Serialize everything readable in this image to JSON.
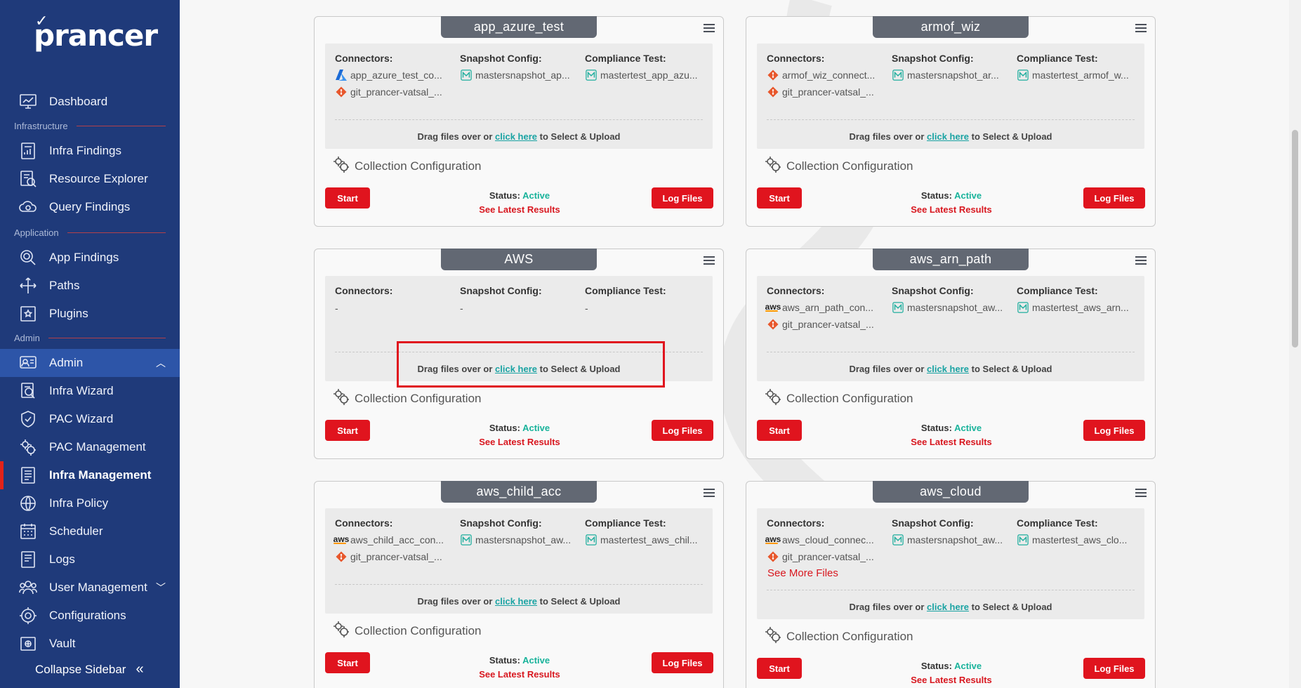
{
  "brand": "prancer",
  "sidebar": {
    "dashboard": "Dashboard",
    "sections": {
      "infrastructure": "Infrastructure",
      "application": "Application",
      "admin": "Admin"
    },
    "items": {
      "infra_findings": "Infra Findings",
      "resource_explorer": "Resource Explorer",
      "query_findings": "Query Findings",
      "app_findings": "App Findings",
      "paths": "Paths",
      "plugins": "Plugins",
      "admin": "Admin",
      "infra_wizard": "Infra Wizard",
      "pac_wizard": "PAC Wizard",
      "pac_management": "PAC Management",
      "infra_management": "Infra Management",
      "infra_policy": "Infra Policy",
      "scheduler": "Scheduler",
      "logs": "Logs",
      "user_management": "User Management",
      "configurations": "Configurations",
      "vault": "Vault"
    },
    "collapse": "Collapse Sidebar"
  },
  "labels": {
    "connectors": "Connectors:",
    "snapshot": "Snapshot Config:",
    "compliance": "Compliance Test:",
    "drag_pre": "Drag files over or ",
    "drag_link": "click here",
    "drag_post": " to Select & Upload",
    "collection": "Collection Configuration",
    "start": "Start",
    "log_files": "Log Files",
    "status": "Status: ",
    "active": "Active",
    "latest": "See Latest Results",
    "see_more": "See More Files",
    "dash": "-"
  },
  "cards": [
    {
      "title": "app_azure_test",
      "conn1": "app_azure_test_co...",
      "conn2": "git_prancer-vatsal_...",
      "snap": "mastersnapshot_ap...",
      "comp": "mastertest_app_azu..."
    },
    {
      "title": "armof_wiz",
      "conn1": "armof_wiz_connect...",
      "conn2": "git_prancer-vatsal_...",
      "snap": "mastersnapshot_ar...",
      "comp": "mastertest_armof_w..."
    },
    {
      "title": "AWS"
    },
    {
      "title": "aws_arn_path",
      "conn1": "aws_arn_path_con...",
      "conn2": "git_prancer-vatsal_...",
      "snap": "mastersnapshot_aw...",
      "comp": "mastertest_aws_arn..."
    },
    {
      "title": "aws_child_acc",
      "conn1": "aws_child_acc_con...",
      "conn2": "git_prancer-vatsal_...",
      "snap": "mastersnapshot_aw...",
      "comp": "mastertest_aws_chil..."
    },
    {
      "title": "aws_cloud",
      "conn1": "aws_cloud_connec...",
      "conn2": "git_prancer-vatsal_...",
      "snap": "mastersnapshot_aw...",
      "comp": "mastertest_aws_clo..."
    }
  ]
}
